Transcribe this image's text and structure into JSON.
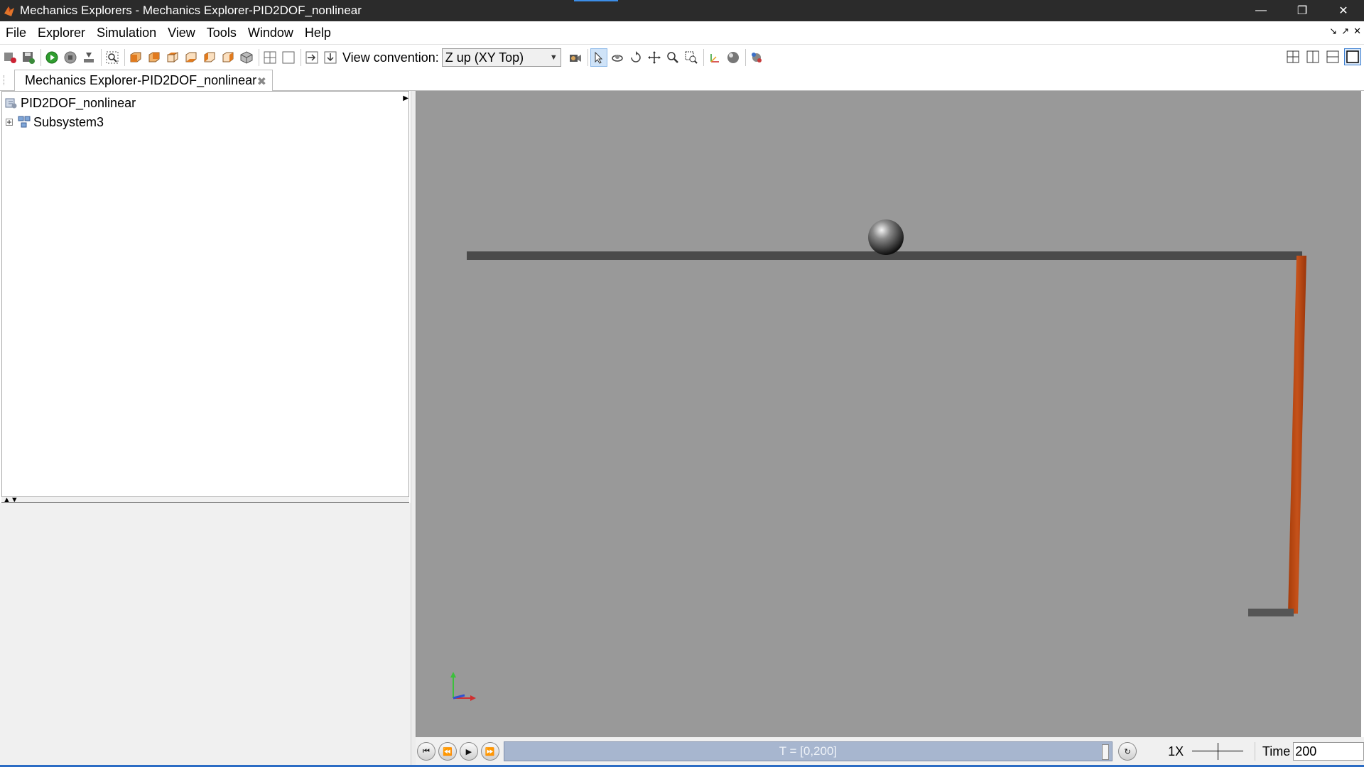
{
  "window": {
    "title": "Mechanics Explorers - Mechanics Explorer-PID2DOF_nonlinear",
    "controls": [
      "minimize-icon",
      "restore-icon",
      "close-icon"
    ]
  },
  "menu": {
    "items": [
      "File",
      "Explorer",
      "Simulation",
      "View",
      "Tools",
      "Window",
      "Help"
    ]
  },
  "toolbar": {
    "view_convention_label": "View convention:",
    "view_convention_value": "Z up (XY Top)"
  },
  "document": {
    "tab_label": "Mechanics Explorer-PID2DOF_nonlinear"
  },
  "tree": {
    "items": [
      {
        "label": "PID2DOF_nonlinear",
        "icon": "model-icon"
      },
      {
        "label": "Subsystem3",
        "icon": "subsystem-icon"
      }
    ]
  },
  "playback": {
    "time_range": "T = [0,200]",
    "speed": "1X",
    "time_label": "Time",
    "time_value": "200"
  },
  "colors": {
    "viewport_bg": "#999999",
    "beam": "#4a4a4a",
    "arm": "#b8470f"
  }
}
